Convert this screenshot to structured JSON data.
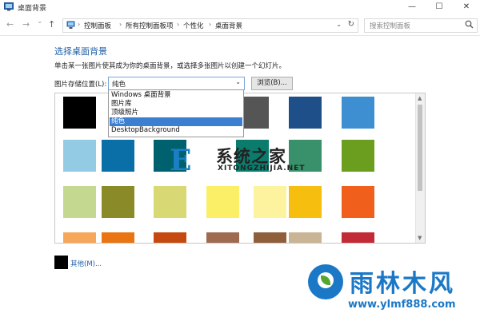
{
  "window": {
    "title": "桌面背景",
    "minimize": "—",
    "maximize": "☐",
    "close": "✕"
  },
  "nav": {
    "back": "←",
    "forward": "→",
    "dropdown": "⌄",
    "up": "↑"
  },
  "address": {
    "crumbs": [
      "控制面板",
      "所有控制面板项",
      "个性化",
      "桌面背景"
    ],
    "separator": "›",
    "dropdown": "⌄",
    "refresh": "↻"
  },
  "search": {
    "placeholder": "搜索控制面板"
  },
  "content": {
    "heading": "选择桌面背景",
    "subtitle": "单击某一张图片使其成为你的桌面背景，或选择多张图片以创建一个幻灯片。",
    "location_label": "图片存储位置(L):",
    "location_value": "纯色",
    "location_arrow": "⌄",
    "browse_label": "浏览(B)...",
    "dropdown_options": [
      "Windows 桌面背景",
      "图片库",
      "顶级照片",
      "纯色",
      "DesktopBackground"
    ],
    "selected_option_index": 3,
    "other_label": "其他(M)..."
  },
  "scrollbar": {
    "up": "▲",
    "down": "▼"
  },
  "swatches": {
    "row1": [
      "#000000",
      "#6e6e6e",
      "#3a3a3a",
      "#555555",
      "#1f4f88",
      "#3e8fd2"
    ],
    "row2": [
      "#93cbe5",
      "#0a6fa7",
      "#00616e",
      "#0b7b6b",
      "#38916b",
      "#6b9e1e"
    ],
    "row3": [
      "#c5d88f",
      "#8a8a28",
      "#d8d874",
      "#fbef67",
      "#fdf29d",
      "#f6be0f",
      "#f05f1c"
    ],
    "row4": [
      "#f7a75a",
      "#e97411",
      "#c64a10",
      "#9e6b50",
      "#8f5e3a",
      "#c9b495",
      "#c22a35"
    ]
  },
  "watermark": {
    "mark": "E",
    "title": "系统之家",
    "subtitle": "XITONGZHIJIA.NET"
  },
  "brand": {
    "name": "雨林木风",
    "url": "www.ylmf888.com",
    "color": "#1b78c7"
  }
}
